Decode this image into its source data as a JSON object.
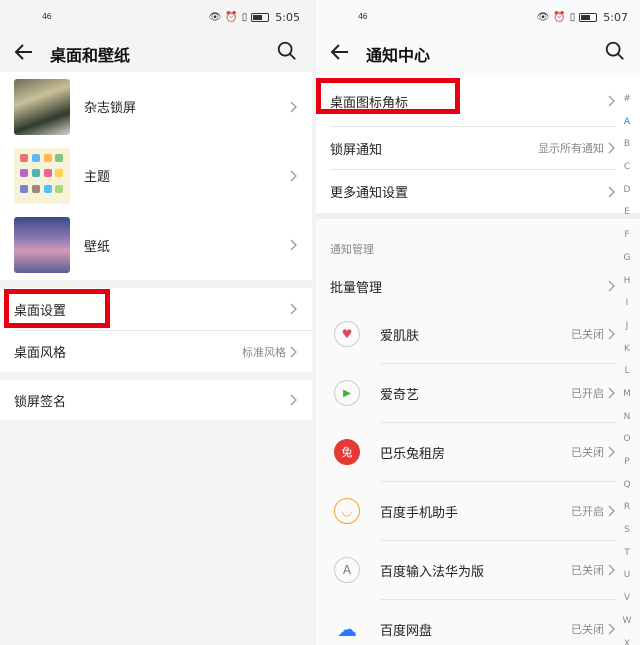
{
  "left": {
    "status": {
      "signal": "46",
      "time": "5:05"
    },
    "title": "桌面和壁纸",
    "theme_items": [
      {
        "label": "杂志锁屏"
      },
      {
        "label": "主题"
      },
      {
        "label": "壁纸"
      }
    ],
    "desktop_settings": "桌面设置",
    "desktop_style": {
      "label": "桌面风格",
      "value": "标准风格"
    },
    "lock_signature": "锁屏签名"
  },
  "right": {
    "status": {
      "signal": "46",
      "time": "5:07"
    },
    "title": "通知中心",
    "badges": "桌面图标角标",
    "lock_notif": {
      "label": "锁屏通知",
      "value": "显示所有通知"
    },
    "more_settings": "更多通知设置",
    "section_label": "通知管理",
    "batch": "批量管理",
    "apps": [
      {
        "name": "爱肌肤",
        "status": "已关闭",
        "icon": "heart-icon",
        "color": "#e0475b",
        "glyph": "♥"
      },
      {
        "name": "爱奇艺",
        "status": "已开启",
        "icon": "play-icon",
        "color": "#2eb82e",
        "glyph": "▶"
      },
      {
        "name": "巴乐兔租房",
        "status": "已关闭",
        "icon": "rabbit-icon",
        "color": "#e53935",
        "glyph": "兔"
      },
      {
        "name": "百度手机助手",
        "status": "已开启",
        "icon": "smile-icon",
        "color": "#f5a623",
        "glyph": "◡"
      },
      {
        "name": "百度输入法华为版",
        "status": "已关闭",
        "icon": "letter-a-icon",
        "color": "#777777",
        "glyph": "A"
      },
      {
        "name": "百度网盘",
        "status": "已关闭",
        "icon": "cloud-icon",
        "color": "#2979ff",
        "glyph": "☁"
      }
    ],
    "alphabet": [
      "#",
      "A",
      "B",
      "C",
      "D",
      "E",
      "F",
      "G",
      "H",
      "I",
      "J",
      "K",
      "L",
      "M",
      "N",
      "O",
      "P",
      "Q",
      "R",
      "S",
      "T",
      "U",
      "V",
      "W",
      "X"
    ]
  },
  "colors": {
    "highlight": "#e60012",
    "accent": "#1a73e8"
  }
}
